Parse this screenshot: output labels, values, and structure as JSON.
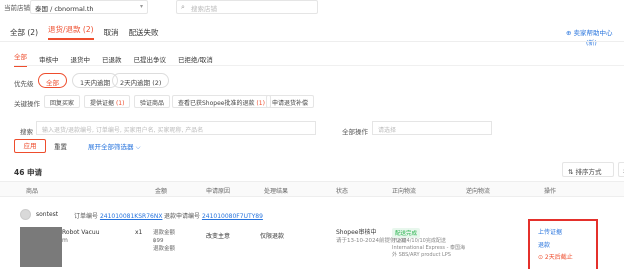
{
  "topbar": {
    "store_label": "当前店铺",
    "store_value": "泰国 / cbnormal.th",
    "search_placeholder": "搜索店铺"
  },
  "main_tabs": [
    {
      "label": "全部 (2)",
      "active": false
    },
    {
      "label": "退货/退款 (2)",
      "active": true
    },
    {
      "label": "取消",
      "active": false
    },
    {
      "label": "配送失败",
      "active": false
    }
  ],
  "help": {
    "label": "卖家帮助中心",
    "sub": "(新)"
  },
  "sub_tabs": [
    {
      "label": "全部",
      "active": true
    },
    {
      "label": "审核中",
      "active": false
    },
    {
      "label": "退货中",
      "active": false
    },
    {
      "label": "已退款",
      "active": false
    },
    {
      "label": "已提出争议",
      "active": false
    },
    {
      "label": "已拒绝/取消",
      "active": false
    }
  ],
  "priority": {
    "label": "优先级",
    "options": [
      "全部",
      "1天内逾期",
      "2天内逾期 (2)"
    ]
  },
  "key_ops": {
    "label": "关键操作",
    "items": [
      {
        "label": "回复买家",
        "count": ""
      },
      {
        "label": "提供证据",
        "count": "(1)"
      },
      {
        "label": "验证商品",
        "count": ""
      },
      {
        "label": "查看已获Shopee批准的退款",
        "count": "(1)"
      },
      {
        "label": "申请退货补偿",
        "count": ""
      }
    ]
  },
  "search": {
    "label": "搜索",
    "placeholder": "输入退货/退款编号, 订单编号, 买家用户名, 买家昵称, 产品名",
    "allops_label": "全部操作",
    "allops_placeholder": "请选择"
  },
  "buttons": {
    "apply": "应用",
    "reset": "重置",
    "expand": "展开全部筛选器 ⌵",
    "sort": "⇅ 排序方式",
    "export": "导"
  },
  "count_label": "46 申请",
  "table_headers": [
    "商品",
    "金额",
    "申请原因",
    "处理结果",
    "状态",
    "正向物流",
    "逆向物流",
    "操作"
  ],
  "order": {
    "buyer": "sontest",
    "order_label": "订单编号",
    "order_no": "241010081KSR76NX",
    "refund_label": "退款申请编号",
    "refund_no": "241010080F7UTY89",
    "product_name": "Robot Vacuu",
    "product_sku": "m",
    "qty": "x1",
    "amount_lines": [
      "退款金额",
      "฿99",
      "退款金额"
    ],
    "reason": "改变主意",
    "result": "仅限退款",
    "status": "Shopee审核中",
    "status_sub": "请于13-10-2024前提供证据",
    "badge": "配送完成",
    "logistics": "于2024/10/10完成配送 International Express - 泰国海外 SBS/ARY product LPS",
    "actions": [
      {
        "label": "上传证据",
        "color": "#2673dd"
      },
      {
        "label": "退款",
        "color": "#2673dd"
      },
      {
        "label": "⊙ 2天后截止",
        "color": "#ee4d2d"
      }
    ]
  }
}
